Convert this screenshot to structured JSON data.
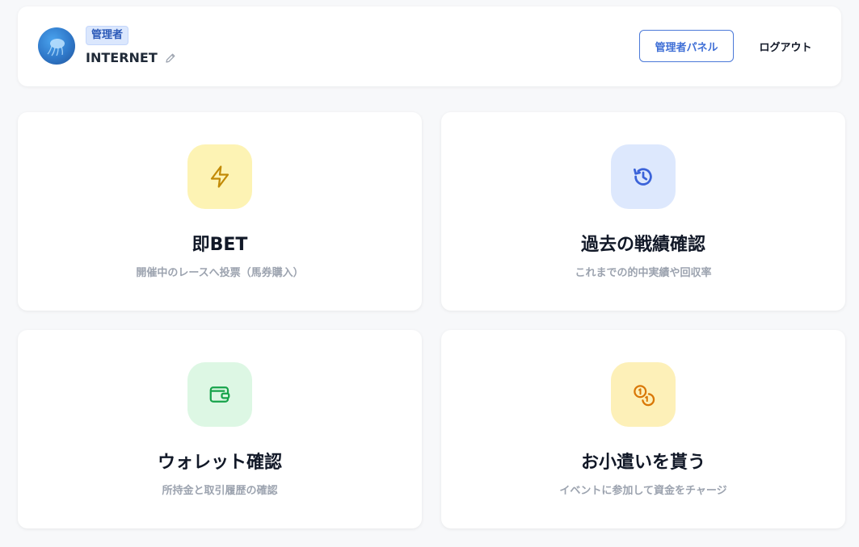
{
  "user": {
    "role_badge": "管理者",
    "name": "INTERNET",
    "avatar_icon": "jellyfish-avatar",
    "edit_icon": "pencil-icon"
  },
  "header": {
    "admin_panel_label": "管理者パネル",
    "logout_label": "ログアウト"
  },
  "cards": [
    {
      "title": "即BET",
      "description": "開催中のレースへ投票（馬券購入）",
      "icon": "lightning-icon",
      "tile_color": "#fdf3b4",
      "icon_color": "#c28a06"
    },
    {
      "title": "過去の戦績確認",
      "description": "これまでの的中実績や回収率",
      "icon": "history-icon",
      "tile_color": "#dde8fd",
      "icon_color": "#3b63d9"
    },
    {
      "title": "ウォレット確認",
      "description": "所持金と取引履歴の確認",
      "icon": "wallet-icon",
      "tile_color": "#ddf7e4",
      "icon_color": "#16a34a"
    },
    {
      "title": "お小遣いを貰う",
      "description": "イベントに参加して資金をチャージ",
      "icon": "coins-icon",
      "tile_color": "#fdf0b8",
      "icon_color": "#d97706"
    }
  ]
}
